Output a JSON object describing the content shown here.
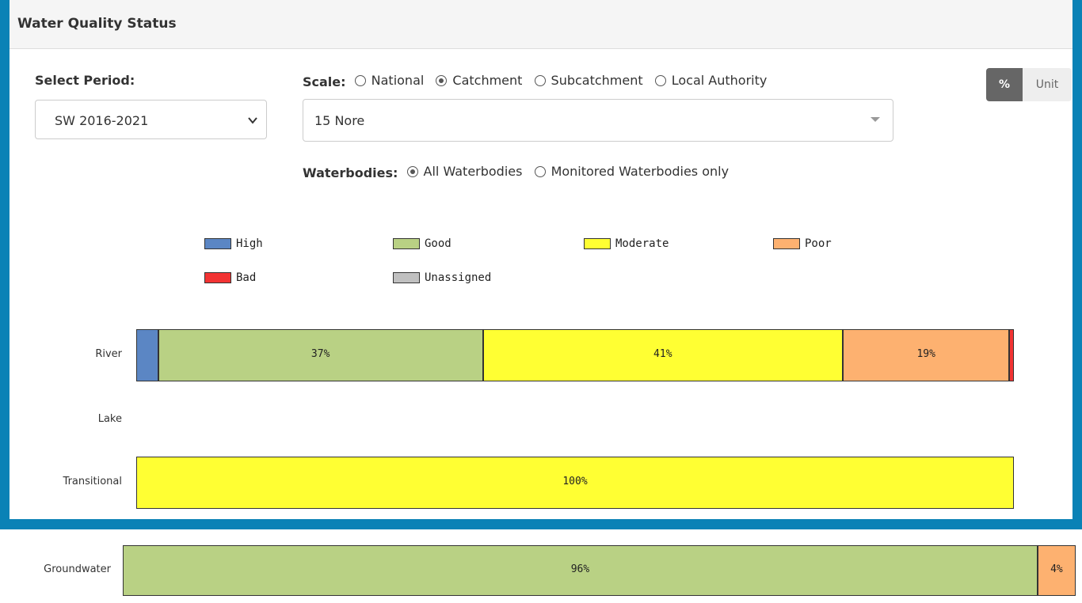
{
  "header": {
    "title": "Water Quality Status"
  },
  "period": {
    "label": "Select Period:",
    "value": "SW 2016-2021"
  },
  "scale": {
    "label": "Scale:",
    "options": [
      {
        "label": "National",
        "selected": false
      },
      {
        "label": "Catchment",
        "selected": true
      },
      {
        "label": "Subcatchment",
        "selected": false
      },
      {
        "label": "Local Authority",
        "selected": false
      }
    ],
    "value": "15 Nore"
  },
  "waterbodies": {
    "label": "Waterbodies:",
    "options": [
      {
        "label": "All Waterbodies",
        "selected": true
      },
      {
        "label": "Monitored Waterbodies only",
        "selected": false
      }
    ]
  },
  "toggle": {
    "percent_label": "%",
    "unit_label": "Unit",
    "active": "percent"
  },
  "chart_data": {
    "type": "bar",
    "orientation": "horizontal",
    "stacked": true,
    "legend": [
      {
        "name": "High",
        "color": "#5b86c4"
      },
      {
        "name": "Good",
        "color": "#b9d184"
      },
      {
        "name": "Moderate",
        "color": "#ffff33"
      },
      {
        "name": "Poor",
        "color": "#fdb170"
      },
      {
        "name": "Bad",
        "color": "#f23333"
      },
      {
        "name": "Unassigned",
        "color": "#c0c0c0"
      }
    ],
    "categories": [
      "River",
      "Lake",
      "Transitional",
      "Groundwater"
    ],
    "series": [
      {
        "name": "High",
        "values": [
          2.5,
          0,
          0,
          0
        ]
      },
      {
        "name": "Good",
        "values": [
          37,
          0,
          0,
          96
        ]
      },
      {
        "name": "Moderate",
        "values": [
          41,
          0,
          100,
          0
        ]
      },
      {
        "name": "Poor",
        "values": [
          19,
          0,
          0,
          4
        ]
      },
      {
        "name": "Bad",
        "values": [
          0.5,
          0,
          0,
          0
        ]
      },
      {
        "name": "Unassigned",
        "values": [
          0,
          0,
          0,
          0
        ]
      }
    ],
    "data_labels": {
      "River": {
        "Good": "37%",
        "Moderate": "41%",
        "Poor": "19%"
      },
      "Transitional": {
        "Moderate": "100%"
      },
      "Groundwater": {
        "Good": "96%",
        "Poor": "4%"
      }
    },
    "xlim": [
      0,
      100
    ]
  }
}
